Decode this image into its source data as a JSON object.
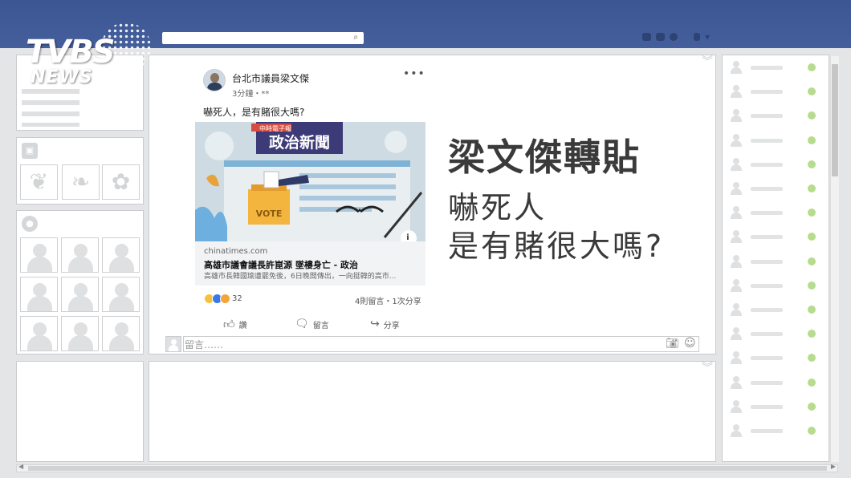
{
  "search": {
    "placeholder": ""
  },
  "logo": {
    "line1": "TVBS",
    "line2": "NEWS"
  },
  "post": {
    "author": "台北市議員梁文傑",
    "time": "3分鐘・**",
    "text": "嚇死人，是有賭很大嗎?",
    "share": {
      "image_banner": "政治新聞",
      "image_tag": "中時電子報",
      "vote_label": "VOTE",
      "source": "chinatimes.com",
      "title": "高雄市議會議長許崑源 墜樓身亡 - 政治",
      "desc": "高雄市長韓國瑜遭罷免後，6日晚間傳出，一向挺韓的高市..."
    },
    "reaction_count": "32",
    "comments_shares": "4則留言・1次分享",
    "actions": {
      "like": "讚",
      "comment": "留言",
      "share": "分享"
    },
    "comment_placeholder": "留言……"
  },
  "overlay": {
    "headline": "梁文傑轉貼",
    "line1": "嚇死人",
    "line2": "是有賭很大嗎?"
  },
  "colors": {
    "topbar": "#3b5693",
    "online_dot": "#b6dc8e",
    "reaction_blue": "#3b78e7",
    "reaction_yellow": "#f5c33b"
  },
  "icons": [
    "search-icon",
    "friends-icon",
    "messages-icon",
    "globe-icon",
    "more-icon",
    "like-icon",
    "comment-icon",
    "share-icon",
    "camera-icon",
    "emoji-icon",
    "info-icon"
  ]
}
